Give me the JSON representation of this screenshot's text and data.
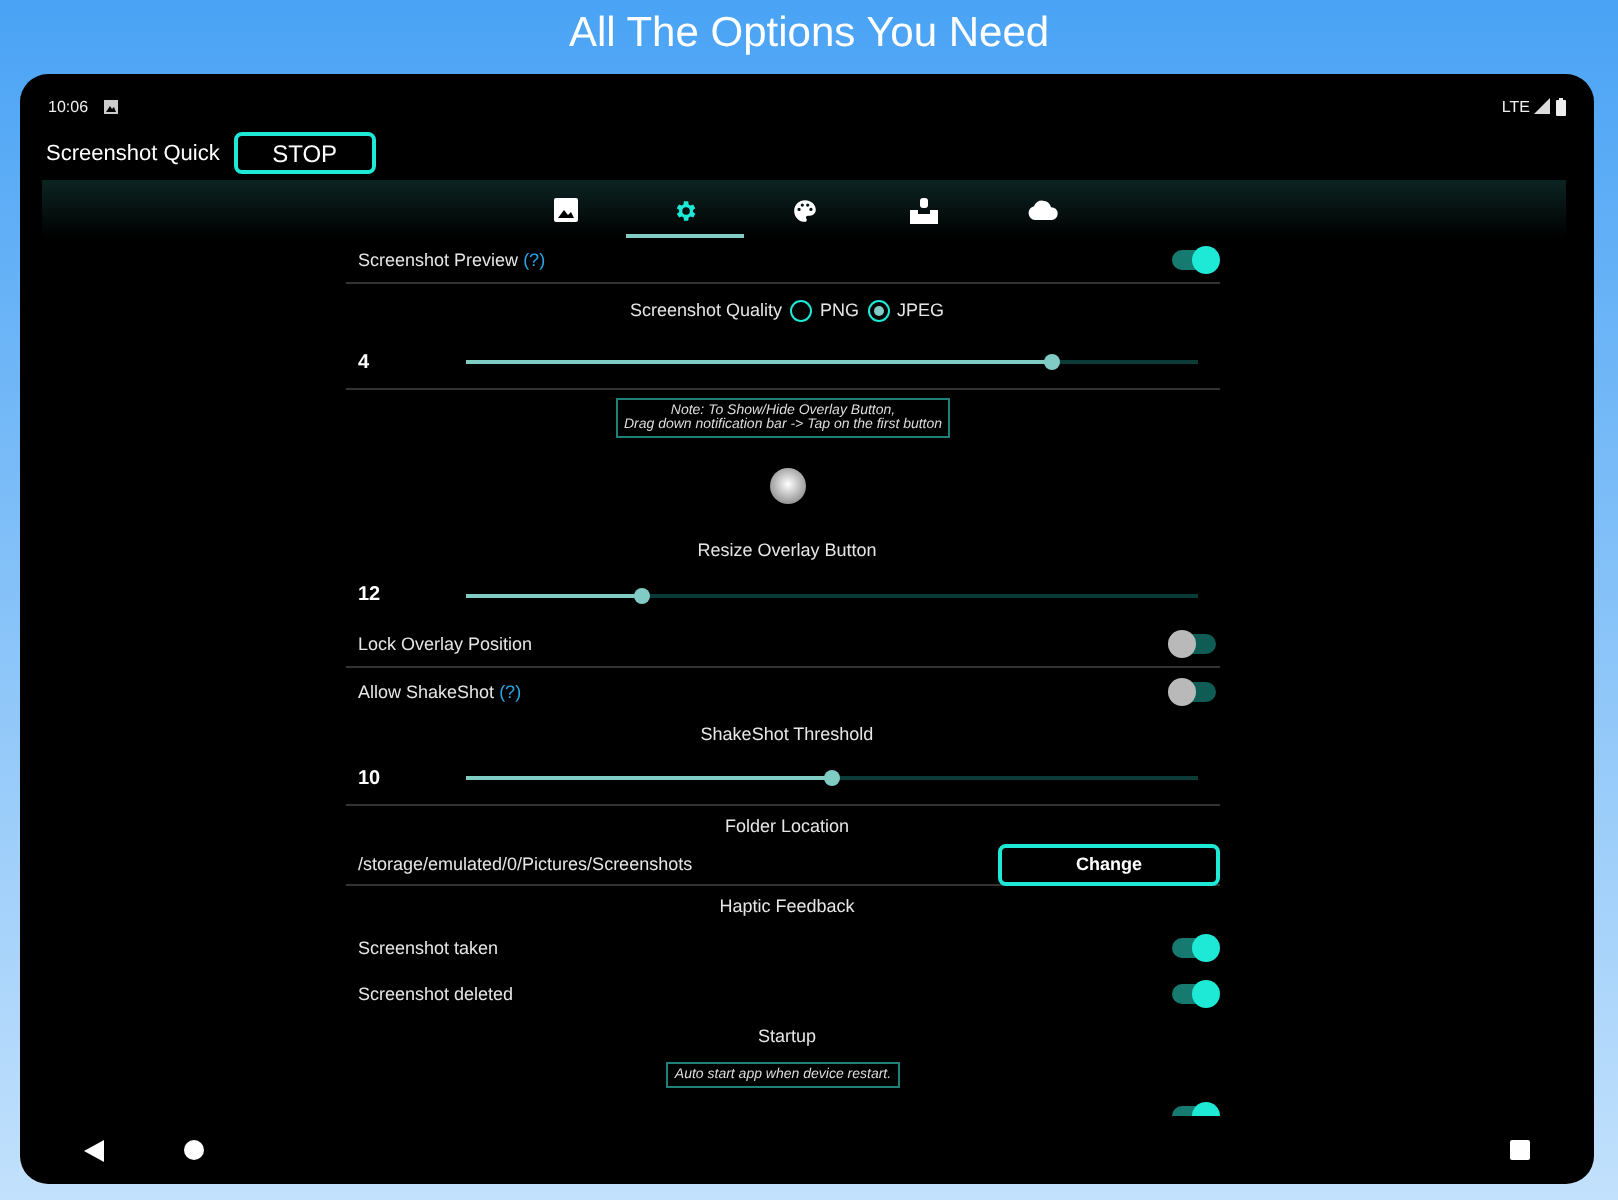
{
  "headline": "All The Options You Need",
  "status_bar": {
    "time": "10:06",
    "network": "LTE"
  },
  "app_bar": {
    "title": "Screenshot Quick",
    "button": "STOP"
  },
  "tabs": [
    {
      "selected": false
    },
    {
      "selected": true
    },
    {
      "selected": false
    },
    {
      "selected": false
    },
    {
      "selected": false
    }
  ],
  "settings": [
    {
      "kind": "toggle",
      "label": "Screenshot Preview",
      "help": "(?)",
      "on": true,
      "divider": true
    },
    {
      "kind": "radio",
      "label": "Screenshot Quality",
      "options": [
        {
          "label": "PNG",
          "selected": false
        },
        {
          "label": "JPEG",
          "selected": true
        }
      ]
    },
    {
      "kind": "slider",
      "value": "4",
      "level": 0.8,
      "divider": true
    },
    {
      "kind": "note",
      "text": "Note: To Show/Hide Overlay Button,\nDrag down notification bar -> Tap on the first button"
    },
    {
      "kind": "overlay"
    },
    {
      "kind": "heading",
      "label": "Resize Overlay Button"
    },
    {
      "kind": "slider",
      "value": "12",
      "level": 0.24
    },
    {
      "kind": "toggle",
      "label": "Lock Overlay Position",
      "on": false,
      "divider": true
    },
    {
      "kind": "toggle",
      "label": "Allow ShakeShot",
      "help": "(?)",
      "on": false
    },
    {
      "kind": "heading",
      "label": "ShakeShot Threshold"
    },
    {
      "kind": "slider",
      "value": "10",
      "level": 0.5,
      "divider": true
    },
    {
      "kind": "heading",
      "label": "Folder Location"
    },
    {
      "kind": "folder",
      "path": "/storage/emulated/0/Pictures/Screenshots",
      "button": "Change",
      "divider": true
    },
    {
      "kind": "heading",
      "label": "Haptic Feedback"
    },
    {
      "kind": "toggle",
      "label": "Screenshot taken",
      "on": true
    },
    {
      "kind": "toggle",
      "label": "Screenshot deleted",
      "on": true
    },
    {
      "kind": "heading",
      "label": "Startup"
    },
    {
      "kind": "note",
      "text": "Auto start app when device restart."
    },
    {
      "kind": "toggle",
      "on": true
    }
  ]
}
